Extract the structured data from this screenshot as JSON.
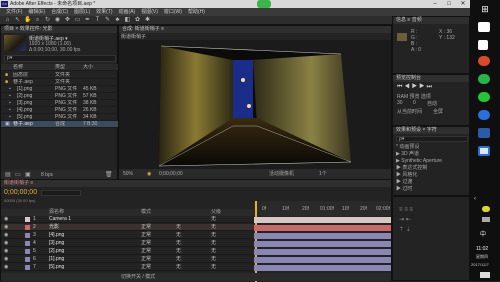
{
  "window": {
    "title": "Adobe After Effects - 未命名项目.aep *"
  },
  "menu": [
    "文件(F)",
    "编辑(E)",
    "合成(C)",
    "图层(L)",
    "效果(T)",
    "动画(A)",
    "视图(V)",
    "窗口(W)",
    "帮助(H)"
  ],
  "project": {
    "tab": "项目 ×  效果控件: 光影",
    "comp_name": "街道街梢子.aep ▾",
    "comp_info": "1920 x 1080 (1.00)",
    "comp_duration": "Δ 0;00;10;00, 30.00 fps",
    "search_placeholder": "ρ▾",
    "header_name": "名称",
    "header_type": "类型",
    "header_size": "大小",
    "items": [
      {
        "name": "固态层",
        "type": "文件夹",
        "size": ""
      },
      {
        "name": "巷子.aep",
        "type": "文件夹",
        "size": ""
      },
      {
        "name": "[1].png",
        "type": "PNG 文件",
        "size": "45 KB"
      },
      {
        "name": "[2].png",
        "type": "PNG 文件",
        "size": "57 KB"
      },
      {
        "name": "[3].png",
        "type": "PNG 文件",
        "size": "38 KB"
      },
      {
        "name": "[4].png",
        "type": "PNG 文件",
        "size": "26 KB"
      },
      {
        "name": "[5].png",
        "type": "PNG 文件",
        "size": "34 KB"
      },
      {
        "name": "巷子.aep",
        "type": "合成",
        "size": "7 B:30"
      }
    ],
    "bpc": "8 bpc"
  },
  "composition": {
    "tab": "合成: 街道街梢子 ≡",
    "subtab": "街道街梢子",
    "zoom": "50%",
    "timecode": "0;00;00;00",
    "view": "活动摄像机",
    "views": "1个"
  },
  "info": {
    "tab": "信息 ≡  音频",
    "r": "R :",
    "g": "G :",
    "b": "B :",
    "a": "A : 0",
    "x": "X : 36",
    "y": "Y : 132"
  },
  "preview": {
    "tab": "预览控制台",
    "ram": "RAM 预览 选项",
    "fps": "30",
    "skip": "0",
    "res": "自动",
    "from": "从当前时间",
    "full": "全屏"
  },
  "effects": {
    "tab": "效果和预设 ×  字符",
    "search": "ρ▾",
    "items": [
      "* 动画预设",
      "▶ 3D 声道",
      "▶ Synthetic Aperture",
      "▶ 表达式控制",
      "▶ 风格化",
      "▶ 过渡",
      "▶ 过时"
    ]
  },
  "timeline": {
    "tab": "街道街梢子 ≡",
    "timecode": "0;00;00;00",
    "frames": "00000 (30.00 fps)",
    "col_source": "源名称",
    "col_mode": "模式",
    "col_parent": "父级",
    "ruler": [
      "0f",
      "10f",
      "20f",
      "01:00f",
      "10f",
      "20f",
      "02:00f"
    ],
    "layers": [
      {
        "num": "1",
        "name": "Camera 1",
        "mode": "",
        "trk": "",
        "parent": "无",
        "color": "#d9c7c7"
      },
      {
        "num": "2",
        "name": "光影",
        "mode": "正常",
        "trk": "无",
        "parent": "无",
        "color": "#c96a6a"
      },
      {
        "num": "3",
        "name": "[4].png",
        "mode": "正常",
        "trk": "无",
        "parent": "无",
        "color": "#8a86b3"
      },
      {
        "num": "4",
        "name": "[3].png",
        "mode": "正常",
        "trk": "无",
        "parent": "无",
        "color": "#8a86b3"
      },
      {
        "num": "5",
        "name": "[2].png",
        "mode": "正常",
        "trk": "无",
        "parent": "无",
        "color": "#8a86b3"
      },
      {
        "num": "6",
        "name": "[1].png",
        "mode": "正常",
        "trk": "无",
        "parent": "无",
        "color": "#8a86b3"
      },
      {
        "num": "7",
        "name": "[5].png",
        "mode": "正常",
        "trk": "无",
        "parent": "无",
        "color": "#8a86b3"
      }
    ],
    "footer": "切换开关 / 模式"
  },
  "taskbar": {
    "time": "11:02",
    "weekday": "星期四",
    "date": "2017/12/7",
    "lang": "中"
  }
}
